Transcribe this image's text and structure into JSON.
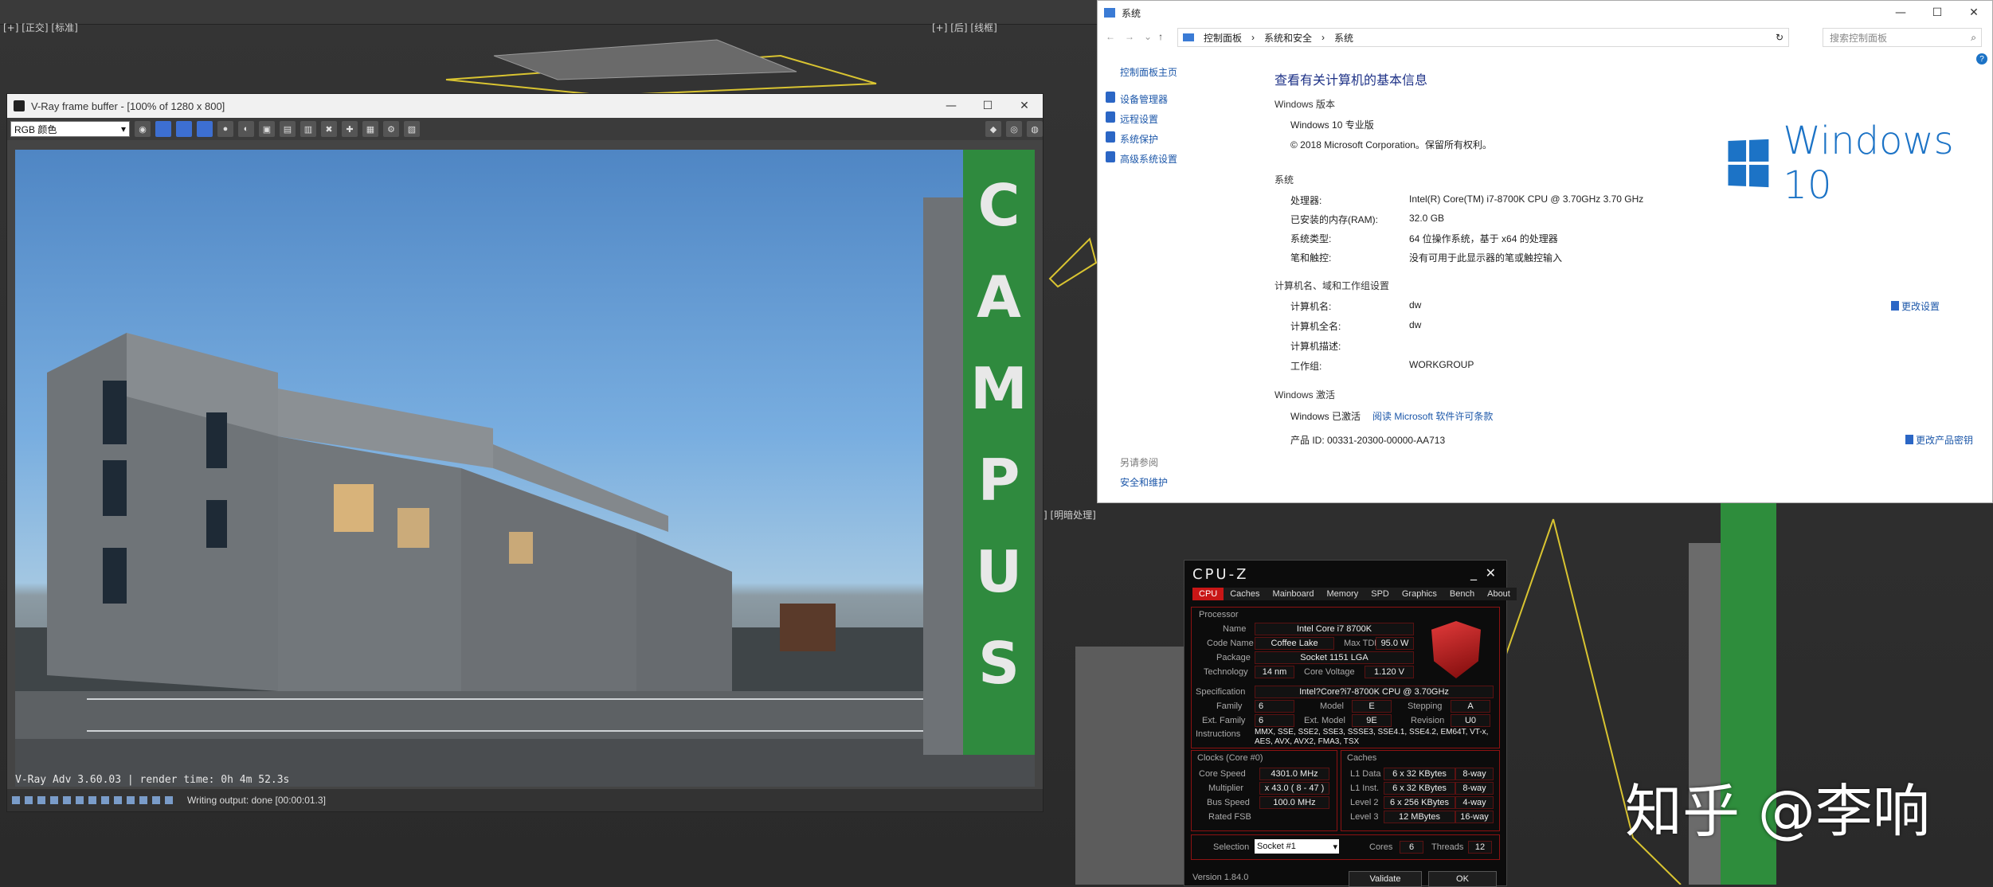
{
  "max": {
    "viewport_labels": [
      "[+] [正交] [标准]",
      "[+] [后] [线框]",
      "] [明暗处理]"
    ]
  },
  "vray": {
    "title": "V-Ray frame buffer - [100% of 1280 x 800]",
    "channel_select": "RGB 颜色",
    "render_info": "V-Ray Adv 3.60.03 | render time:  0h  4m 52.3s",
    "status": "Writing output: done [00:00:01.3]",
    "sign_letters": [
      "C",
      "A",
      "M",
      "P",
      "U",
      "S"
    ]
  },
  "sys": {
    "title": "系统",
    "breadcrumb": [
      "控制面板",
      "系统和安全",
      "系统"
    ],
    "search_placeholder": "搜索控制面板",
    "left_links": [
      "控制面板主页",
      "设备管理器",
      "远程设置",
      "系统保护",
      "高级系统设置"
    ],
    "see_also_title": "另请参阅",
    "see_also_link": "安全和维护",
    "heading": "查看有关计算机的基本信息",
    "edition_section": "Windows 版本",
    "edition": "Windows 10 专业版",
    "copyright": "© 2018 Microsoft Corporation。保留所有权利。",
    "logo_text": "Windows 10",
    "system_section": "系统",
    "system_rows": [
      {
        "label": "处理器:",
        "value": "Intel(R) Core(TM) i7-8700K CPU @ 3.70GHz   3.70 GHz"
      },
      {
        "label": "已安装的内存(RAM):",
        "value": "32.0 GB"
      },
      {
        "label": "系统类型:",
        "value": "64 位操作系统，基于 x64 的处理器"
      },
      {
        "label": "笔和触控:",
        "value": "没有可用于此显示器的笔或触控输入"
      }
    ],
    "name_section": "计算机名、域和工作组设置",
    "name_rows": [
      {
        "label": "计算机名:",
        "value": "dw"
      },
      {
        "label": "计算机全名:",
        "value": "dw"
      },
      {
        "label": "计算机描述:",
        "value": ""
      },
      {
        "label": "工作组:",
        "value": "WORKGROUP"
      }
    ],
    "change_settings": "更改设置",
    "activation_section": "Windows 激活",
    "activated": "Windows 已激活",
    "license_link": "阅读 Microsoft 软件许可条款",
    "product_id": "产品 ID: 00331-20300-00000-AA713",
    "change_key": "更改产品密钥"
  },
  "cpuz": {
    "title": "CPU-Z",
    "tabs": [
      "CPU",
      "Caches",
      "Mainboard",
      "Memory",
      "SPD",
      "Graphics",
      "Bench",
      "About"
    ],
    "processor_label": "Processor",
    "name_label": "Name",
    "name": "Intel Core i7 8700K",
    "codename_label": "Code Name",
    "codename": "Coffee Lake",
    "maxtdp_label": "Max TDP",
    "maxtdp": "95.0 W",
    "package_label": "Package",
    "package": "Socket 1151 LGA",
    "tech_label": "Technology",
    "tech": "14 nm",
    "voltage_label": "Core Voltage",
    "voltage": "1.120 V",
    "spec_label": "Specification",
    "spec": "Intel?Core?i7-8700K CPU @ 3.70GHz",
    "family_label": "Family",
    "family": "6",
    "model_label": "Model",
    "model": "E",
    "stepping_label": "Stepping",
    "stepping": "A",
    "extfamily_label": "Ext. Family",
    "extfamily": "6",
    "extmodel_label": "Ext. Model",
    "extmodel": "9E",
    "revision_label": "Revision",
    "revision": "U0",
    "instr_label": "Instructions",
    "instr": "MMX, SSE, SSE2, SSE3, SSSE3, SSE4.1, SSE4.2, EM64T, VT-x, AES, AVX, AVX2, FMA3, TSX",
    "clocks_label": "Clocks (Core #0)",
    "corespeed_label": "Core Speed",
    "corespeed": "4301.0 MHz",
    "multiplier_label": "Multiplier",
    "multiplier": "x 43.0 ( 8 - 47 )",
    "busspeed_label": "Bus Speed",
    "busspeed": "100.0 MHz",
    "ratedfsb_label": "Rated FSB",
    "caches_label": "Caches",
    "l1d_label": "L1 Data",
    "l1d": "6 x 32 KBytes",
    "l1d_way": "8-way",
    "l1i_label": "L1 Inst.",
    "l1i": "6 x 32 KBytes",
    "l1i_way": "8-way",
    "l2_label": "Level 2",
    "l2": "6 x 256 KBytes",
    "l2_way": "4-way",
    "l3_label": "Level 3",
    "l3": "12 MBytes",
    "l3_way": "16-way",
    "selection_label": "Selection",
    "selection": "Socket #1",
    "cores_label": "Cores",
    "cores": "6",
    "threads_label": "Threads",
    "threads": "12",
    "version": "Version 1.84.0",
    "validate": "Validate",
    "ok": "OK"
  },
  "watermark": "知乎 @李响"
}
